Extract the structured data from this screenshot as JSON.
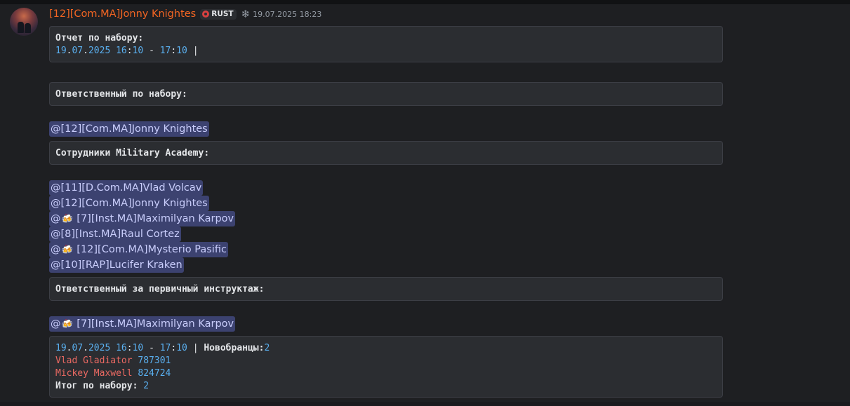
{
  "message": {
    "username": "[12][Com.MA]Jonny Knightes",
    "tag_label": "RUST",
    "tag_icon": "server-tag-icon",
    "decoration": "snowflake-icon",
    "timestamp": "19.07.2025 18:23"
  },
  "blocks": {
    "report": {
      "line1": "Отчет по набору:",
      "date_d": "19",
      "date_m": "07",
      "date_y": "2025",
      "t1h": "16",
      "t1m": "10",
      "t2h": "17",
      "t2m": "10",
      "sep": " | "
    },
    "responsible": "Ответственный по набору:",
    "staff": "Сотрудники Military Academy:",
    "instructor": "Ответственный за первичный инструктаж:",
    "summary": {
      "date_d": "19",
      "date_m": "07",
      "date_y": "2025",
      "t1h": "16",
      "t1m": "10",
      "t2h": "17",
      "t2m": "10",
      "recruits_label": "Новобранцы:",
      "recruits_count": "2",
      "recruit1_name": "Vlad Gladiator",
      "recruit1_id": "787301",
      "recruit2_name": "Mickey Maxwell",
      "recruit2_id": "824724",
      "total_label": "Итог по набору: ",
      "total_value": "2"
    }
  },
  "mentions": {
    "responsible": "@[12][Com.MA]Jonny Knightes",
    "staff": [
      {
        "at": "@",
        "emoji": "",
        "text": "[11][D.Com.MA]Vlad Volcav"
      },
      {
        "at": "@",
        "emoji": "",
        "text": "[12][Com.MA]Jonny Knightes"
      },
      {
        "at": "@",
        "emoji": "🍻",
        "text": "[7][Inst.MA]Maximilyan Karpov"
      },
      {
        "at": "@",
        "emoji": "",
        "text": "[8][Inst.MA]Raul Cortez"
      },
      {
        "at": "@",
        "emoji": "🍻",
        "text": "[12][Com.MA]Mysterio Pasific"
      },
      {
        "at": "@",
        "emoji": "",
        "text": "[10][RAP]Lucifer Kraken"
      }
    ],
    "instructor": {
      "at": "@",
      "emoji": "🍻",
      "text": "[7][Inst.MA]Maximilyan Karpov"
    }
  }
}
